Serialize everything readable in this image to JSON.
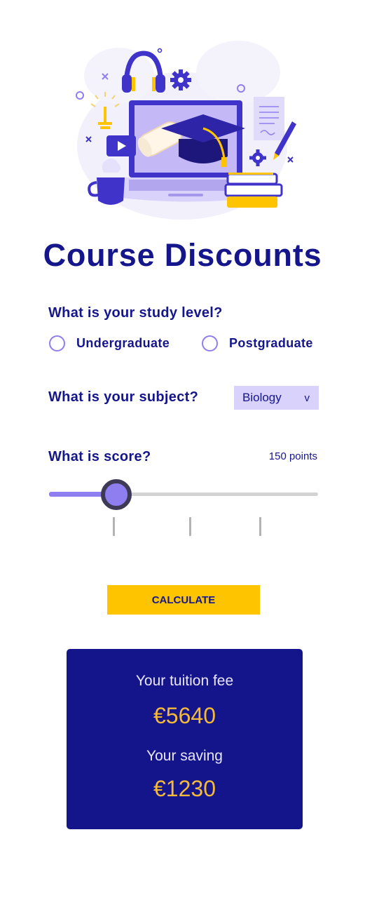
{
  "page": {
    "title": "Course Discounts"
  },
  "study_level": {
    "question": "What is your study level?",
    "options": [
      "Undergraduate",
      "Postgraduate"
    ]
  },
  "subject": {
    "question": "What is your subject?",
    "selected": "Biology",
    "chevron": "v"
  },
  "score": {
    "question": "What is score?",
    "value_text": "150 points",
    "slider_fraction": 0.25
  },
  "calculate": {
    "label": "CALCULATE"
  },
  "result": {
    "fee_label": "Your tuition fee",
    "fee_value": "€5640",
    "saving_label": "Your saving",
    "saving_value": "€1230"
  },
  "colors": {
    "primary": "#15168c",
    "accent": "#8f7ef0",
    "button": "#ffc400",
    "result_bg": "#14148b",
    "result_value": "#f4b93a"
  },
  "icons": [
    "education-illustration",
    "graduation-cap-icon",
    "headphones-icon",
    "gear-icon",
    "lightbulb-icon",
    "play-icon",
    "mug-icon",
    "books-icon",
    "pencil-icon",
    "document-icon"
  ]
}
